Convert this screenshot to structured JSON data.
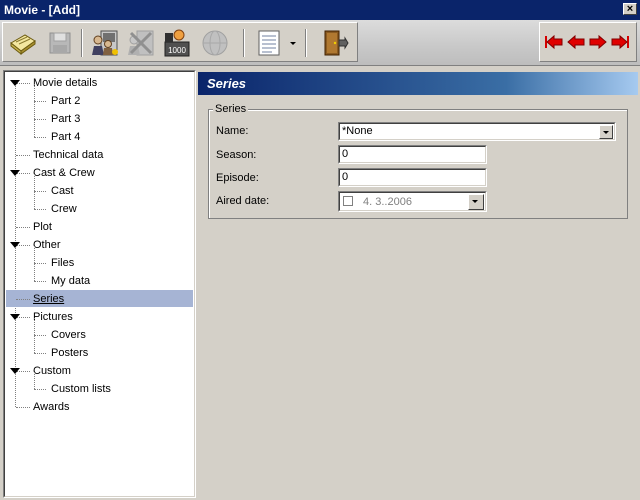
{
  "window": {
    "title": "Movie - [Add]",
    "close_label": "×"
  },
  "toolbar": {
    "buttons": [
      {
        "name": "save-icon"
      },
      {
        "name": "disk-icon"
      },
      {
        "name": "actors-icon"
      },
      {
        "name": "delete-icon"
      },
      {
        "name": "counter-icon",
        "badge": "1000"
      },
      {
        "name": "globe-icon"
      },
      {
        "name": "list-icon"
      },
      {
        "name": "dropdown-arrow-icon"
      },
      {
        "name": "exit-door-icon"
      }
    ],
    "nav": [
      {
        "name": "first-icon"
      },
      {
        "name": "previous-icon"
      },
      {
        "name": "next-icon"
      },
      {
        "name": "last-icon"
      }
    ],
    "arrow_color": "#d40000"
  },
  "tree": {
    "items": [
      {
        "label": "Movie details",
        "level": 0,
        "expandable": true
      },
      {
        "label": "Part 2",
        "level": 1
      },
      {
        "label": "Part 3",
        "level": 1
      },
      {
        "label": "Part 4",
        "level": 1
      },
      {
        "label": "Technical data",
        "level": 0
      },
      {
        "label": "Cast & Crew",
        "level": 0,
        "expandable": true
      },
      {
        "label": "Cast",
        "level": 1
      },
      {
        "label": "Crew",
        "level": 1
      },
      {
        "label": "Plot",
        "level": 0
      },
      {
        "label": "Other",
        "level": 0,
        "expandable": true
      },
      {
        "label": "Files",
        "level": 1
      },
      {
        "label": "My data",
        "level": 1
      },
      {
        "label": "Series",
        "level": 0,
        "selected": true
      },
      {
        "label": "Pictures",
        "level": 0,
        "expandable": true
      },
      {
        "label": "Covers",
        "level": 1
      },
      {
        "label": "Posters",
        "level": 1
      },
      {
        "label": "Custom",
        "level": 0,
        "expandable": true
      },
      {
        "label": "Custom lists",
        "level": 1
      },
      {
        "label": "Awards",
        "level": 0
      }
    ],
    "selected_color": "#a6b4d4"
  },
  "panel": {
    "title": "Series",
    "group_label": "Series",
    "name_label": "Name:",
    "name_value": "*None",
    "season_label": "Season:",
    "season_value": "0",
    "episode_label": "Episode:",
    "episode_value": "0",
    "aired_label": "Aired date:",
    "aired_value": "4. 3..2006"
  },
  "colors": {
    "title_bg": "#0a246a",
    "face": "#d4d0c8"
  }
}
